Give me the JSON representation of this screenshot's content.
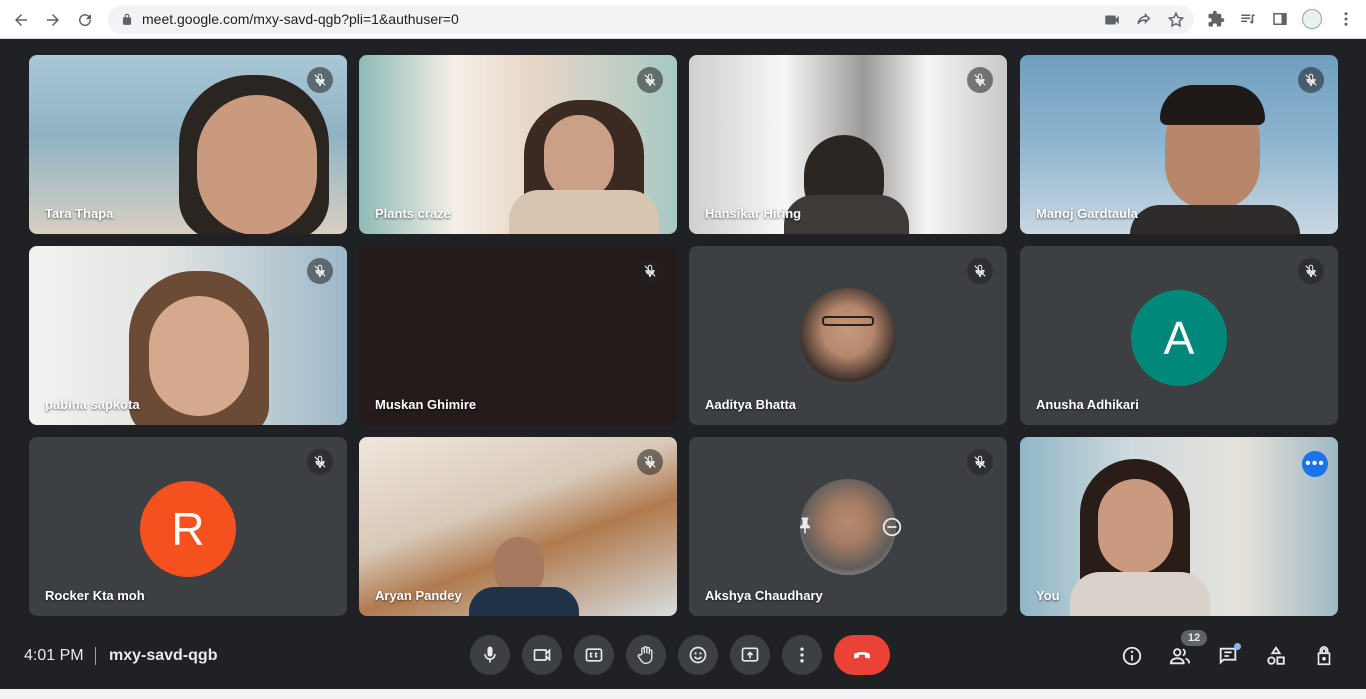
{
  "browser": {
    "url": "meet.google.com/mxy-savd-qgb?pli=1&authuser=0"
  },
  "tiles": [
    {
      "name": "Tara Thapa"
    },
    {
      "name": "Plants craze"
    },
    {
      "name": "Hansikar Hiring"
    },
    {
      "name": "Manoj Gardtaula"
    },
    {
      "name": "pabina sapkota"
    },
    {
      "name": "Muskan Ghimire"
    },
    {
      "name": "Aaditya Bhatta"
    },
    {
      "name": "Anusha Adhikari",
      "avatar_letter": "A",
      "avatar_color": "#00897b"
    },
    {
      "name": "Rocker Kta moh",
      "avatar_letter": "R",
      "avatar_color": "#f4511e"
    },
    {
      "name": "Aryan Pandey"
    },
    {
      "name": "Akshya Chaudhary"
    },
    {
      "name": "You"
    }
  ],
  "meeting": {
    "time": "4:01 PM",
    "code": "mxy-savd-qgb",
    "participant_count": "12"
  },
  "colors": {
    "background": "#202124",
    "tile": "#3c4043",
    "hangup": "#ea4335",
    "accent": "#8ab4f8"
  }
}
